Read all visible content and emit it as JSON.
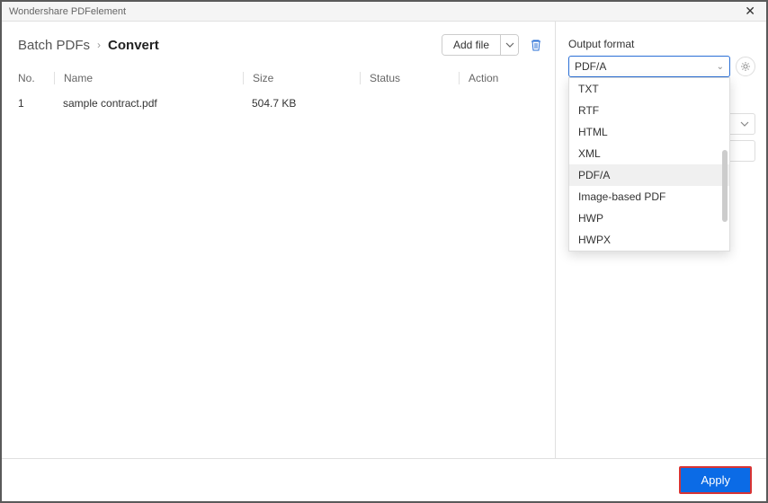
{
  "window": {
    "title": "Wondershare PDFelement"
  },
  "breadcrumb": {
    "root": "Batch PDFs",
    "current": "Convert"
  },
  "toolbar": {
    "addFile": "Add file",
    "trash": "Clear all"
  },
  "table": {
    "headers": {
      "no": "No.",
      "name": "Name",
      "size": "Size",
      "status": "Status",
      "action": "Action"
    },
    "rows": [
      {
        "no": "1",
        "name": "sample contract.pdf",
        "size": "504.7 KB",
        "status": "",
        "action": ""
      }
    ]
  },
  "side": {
    "outputFormatLabel": "Output format",
    "selected": "PDF/A",
    "options": [
      "TXT",
      "RTF",
      "HTML",
      "XML",
      "PDF/A",
      "Image-based PDF",
      "HWP",
      "HWPX"
    ],
    "selectedIndex": 4,
    "more": "···"
  },
  "footer": {
    "apply": "Apply"
  }
}
